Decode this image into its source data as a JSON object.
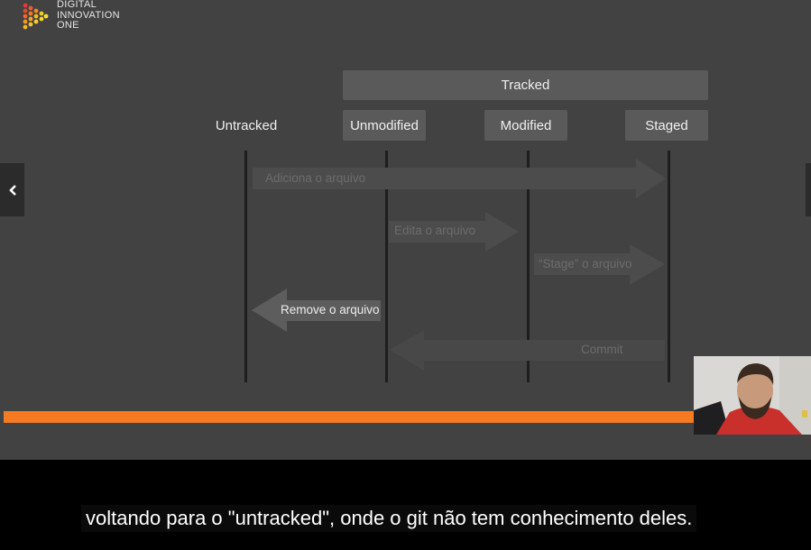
{
  "logo": {
    "lines": [
      "DIGITAL",
      "INNOVATION",
      "ONE"
    ]
  },
  "diagram": {
    "tracked_label": "Tracked",
    "states": {
      "untracked": "Untracked",
      "unmodified": "Unmodified",
      "modified": "Modified",
      "staged": "Staged"
    },
    "actions": {
      "add": "Adiciona o arquivo",
      "edit": "Edita o arquivo",
      "stage": "“Stage” o arquivo",
      "remove": "Remove o arquivo",
      "commit": "Commit"
    }
  },
  "player": {
    "progress_fraction": 0.86,
    "prev_icon": "chevron-left-icon",
    "accent_color": "#f47b20"
  },
  "subtitle": "voltando para o \"untracked\", onde o git não tem conhecimento deles."
}
